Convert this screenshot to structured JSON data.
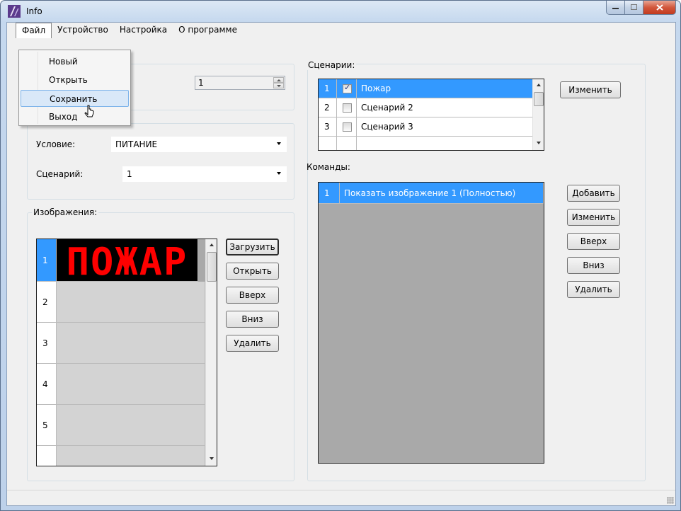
{
  "window": {
    "title": "Info"
  },
  "menu": {
    "items": [
      "Файл",
      "Устройство",
      "Настройка",
      "О программе"
    ],
    "file_dropdown": [
      "Новый",
      "Открыть",
      "Сохранить",
      "Выход"
    ]
  },
  "device": {
    "spin_value": "1"
  },
  "condition": {
    "label_condition": "Условие:",
    "condition_value": "ПИТАНИЕ",
    "label_scenario": "Сценарий:",
    "scenario_value": "1"
  },
  "images": {
    "title": "Изображения:",
    "rows": [
      "1",
      "2",
      "3",
      "4",
      "5"
    ],
    "first_image_text": "ПОЖАР",
    "buttons": {
      "load": "Загрузить",
      "open": "Открыть",
      "up": "Вверх",
      "down": "Вниз",
      "delete": "Удалить"
    }
  },
  "scenarios": {
    "title": "Сценарии:",
    "rows": [
      {
        "num": "1",
        "checked": true,
        "name": "Пожар"
      },
      {
        "num": "2",
        "checked": false,
        "name": "Сценарий 2"
      },
      {
        "num": "3",
        "checked": false,
        "name": "Сценарий 3"
      }
    ],
    "edit_button": "Изменить"
  },
  "commands": {
    "title": "Команды:",
    "rows": [
      {
        "num": "1",
        "text": "Показать изображение 1 (Полностью)"
      }
    ],
    "buttons": {
      "add": "Добавить",
      "edit": "Изменить",
      "up": "Вверх",
      "down": "Вниз",
      "delete": "Удалить"
    }
  },
  "colors": {
    "selection": "#3399ff",
    "led_red": "#ff0000",
    "grid_bg": "#a9a9a9"
  }
}
